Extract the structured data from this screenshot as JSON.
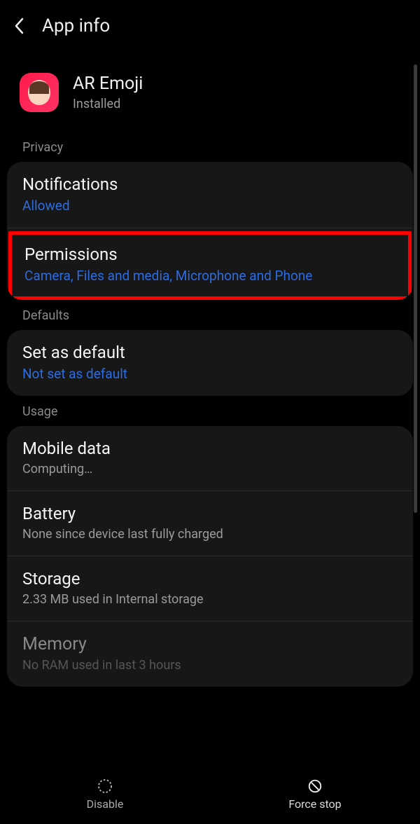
{
  "header": {
    "title": "App info"
  },
  "app": {
    "name": "AR Emoji",
    "status": "Installed"
  },
  "sections": {
    "privacy": {
      "label": "Privacy",
      "notifications": {
        "title": "Notifications",
        "sub": "Allowed"
      },
      "permissions": {
        "title": "Permissions",
        "sub": "Camera, Files and media, Microphone and Phone"
      }
    },
    "defaults": {
      "label": "Defaults",
      "setDefault": {
        "title": "Set as default",
        "sub": "Not set as default"
      }
    },
    "usage": {
      "label": "Usage",
      "mobileData": {
        "title": "Mobile data",
        "sub": "Computing…"
      },
      "battery": {
        "title": "Battery",
        "sub": "None since device last fully charged"
      },
      "storage": {
        "title": "Storage",
        "sub": "2.33 MB used in Internal storage"
      },
      "memory": {
        "title": "Memory",
        "sub": "No RAM used in last 3 hours"
      }
    }
  },
  "bottomBar": {
    "disable": "Disable",
    "forceStop": "Force stop"
  }
}
